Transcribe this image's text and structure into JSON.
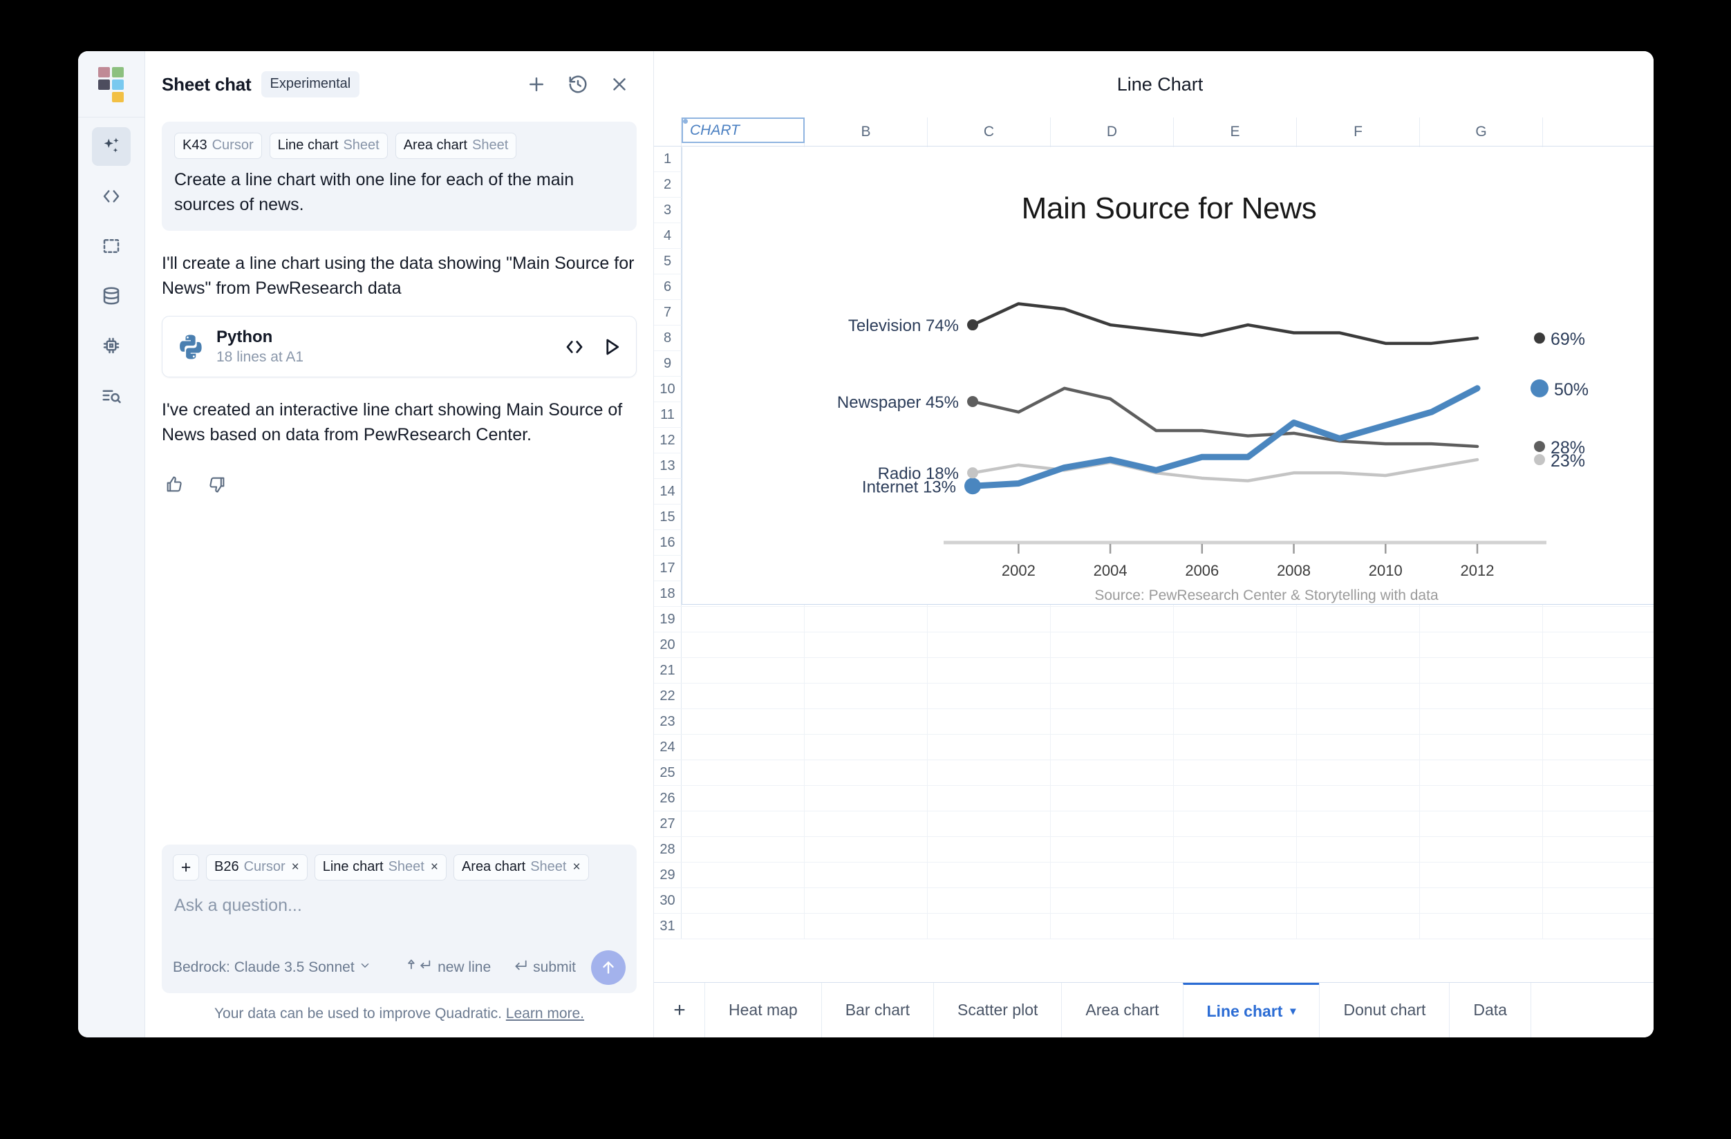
{
  "window": {
    "title": "Line Chart"
  },
  "rail": {
    "logo_colors": [
      "#c08a96",
      "#8cc07f",
      "#4d4d5e",
      "#79c9ef",
      "#f2c044"
    ],
    "items": [
      {
        "name": "ai-sparkles-icon",
        "active": true
      },
      {
        "name": "code-icon",
        "active": false
      },
      {
        "name": "selection-box-icon",
        "active": false
      },
      {
        "name": "database-icon",
        "active": false
      },
      {
        "name": "chip-icon",
        "active": false
      },
      {
        "name": "search-list-icon",
        "active": false
      }
    ]
  },
  "chat": {
    "title": "Sheet chat",
    "experimental_badge": "Experimental",
    "actions": {
      "new": "+",
      "history": "history-icon",
      "close": "close-icon"
    },
    "user_message": {
      "context": [
        {
          "label": "K43",
          "sub": "Cursor"
        },
        {
          "label": "Line chart",
          "sub": "Sheet"
        },
        {
          "label": "Area chart",
          "sub": "Sheet"
        }
      ],
      "text": "Create a line chart with one line for each of the main sources of news."
    },
    "assistant_intro": "I'll create a line chart using the data showing \"Main Source for News\" from PewResearch data",
    "code_card": {
      "language": "Python",
      "meta": "18 lines at A1"
    },
    "assistant_outro": "I've created an interactive line chart showing Main Source of News based on data from PewResearch Center.",
    "composer": {
      "add_label": "+",
      "context": [
        {
          "label": "B26",
          "sub": "Cursor",
          "close": "×"
        },
        {
          "label": "Line chart",
          "sub": "Sheet",
          "close": "×"
        },
        {
          "label": "Area chart",
          "sub": "Sheet",
          "close": "×"
        }
      ],
      "placeholder": "Ask a question...",
      "model": "Bedrock: Claude 3.5 Sonnet",
      "hint_newline": "new line",
      "hint_submit": "submit"
    },
    "privacy": {
      "text": "Your data can be used to improve Quadratic.",
      "link": "Learn more."
    }
  },
  "sheet": {
    "columns": [
      "A",
      "B",
      "C",
      "D",
      "E",
      "F",
      "G",
      ""
    ],
    "rows": [
      1,
      2,
      3,
      4,
      5,
      6,
      7,
      8,
      9,
      10,
      11,
      12,
      13,
      14,
      15,
      16,
      17,
      18,
      19,
      20,
      21,
      22,
      23,
      24,
      25,
      26,
      27,
      28,
      29,
      30,
      31
    ],
    "a1_value": "CHART",
    "tabs": [
      {
        "label": "Heat map",
        "active": false
      },
      {
        "label": "Bar chart",
        "active": false
      },
      {
        "label": "Scatter plot",
        "active": false
      },
      {
        "label": "Area chart",
        "active": false
      },
      {
        "label": "Line chart",
        "active": true,
        "caret": "▾"
      },
      {
        "label": "Donut chart",
        "active": false
      },
      {
        "label": "Data",
        "active": false
      }
    ]
  },
  "chart_data": {
    "type": "line",
    "title": "Main Source for News",
    "xlabel": "",
    "ylabel": "",
    "source_note": "Source: PewResearch Center & Storytelling with data",
    "grid": false,
    "legend": "inline-endpoints",
    "x": [
      2001,
      2002,
      2003,
      2004,
      2005,
      2006,
      2007,
      2008,
      2009,
      2010,
      2011,
      2012
    ],
    "xticks": [
      2002,
      2004,
      2006,
      2008,
      2010,
      2012
    ],
    "xlim": [
      2001,
      2012
    ],
    "ylim": [
      0,
      85
    ],
    "series": [
      {
        "name": "Television",
        "color": "#3b3b3b",
        "start_label": "Television 74%",
        "end_label": "69%",
        "start_value": 74,
        "end_value": 69,
        "values": [
          74,
          82,
          80,
          74,
          72,
          70,
          74,
          71,
          71,
          67,
          67,
          69
        ]
      },
      {
        "name": "Newspaper",
        "color": "#5e5e5e",
        "start_label": "Newspaper 45%",
        "end_label": "28%",
        "start_value": 45,
        "end_value": 28,
        "values": [
          45,
          41,
          50,
          46,
          34,
          34,
          32,
          33,
          30,
          29,
          29,
          28
        ]
      },
      {
        "name": "Internet",
        "color": "#4a86bf",
        "start_label": "Internet 13%",
        "end_label": "50%",
        "start_value": 13,
        "end_value": 50,
        "values": [
          13,
          14,
          20,
          23,
          19,
          24,
          24,
          37,
          31,
          36,
          41,
          50
        ]
      },
      {
        "name": "Radio",
        "color": "#c4c4c4",
        "start_label": "Radio 18%",
        "end_label": "23%",
        "start_value": 18,
        "end_value": 23,
        "values": [
          18,
          21,
          19,
          22,
          18,
          16,
          15,
          18,
          18,
          17,
          20,
          23
        ]
      }
    ]
  }
}
